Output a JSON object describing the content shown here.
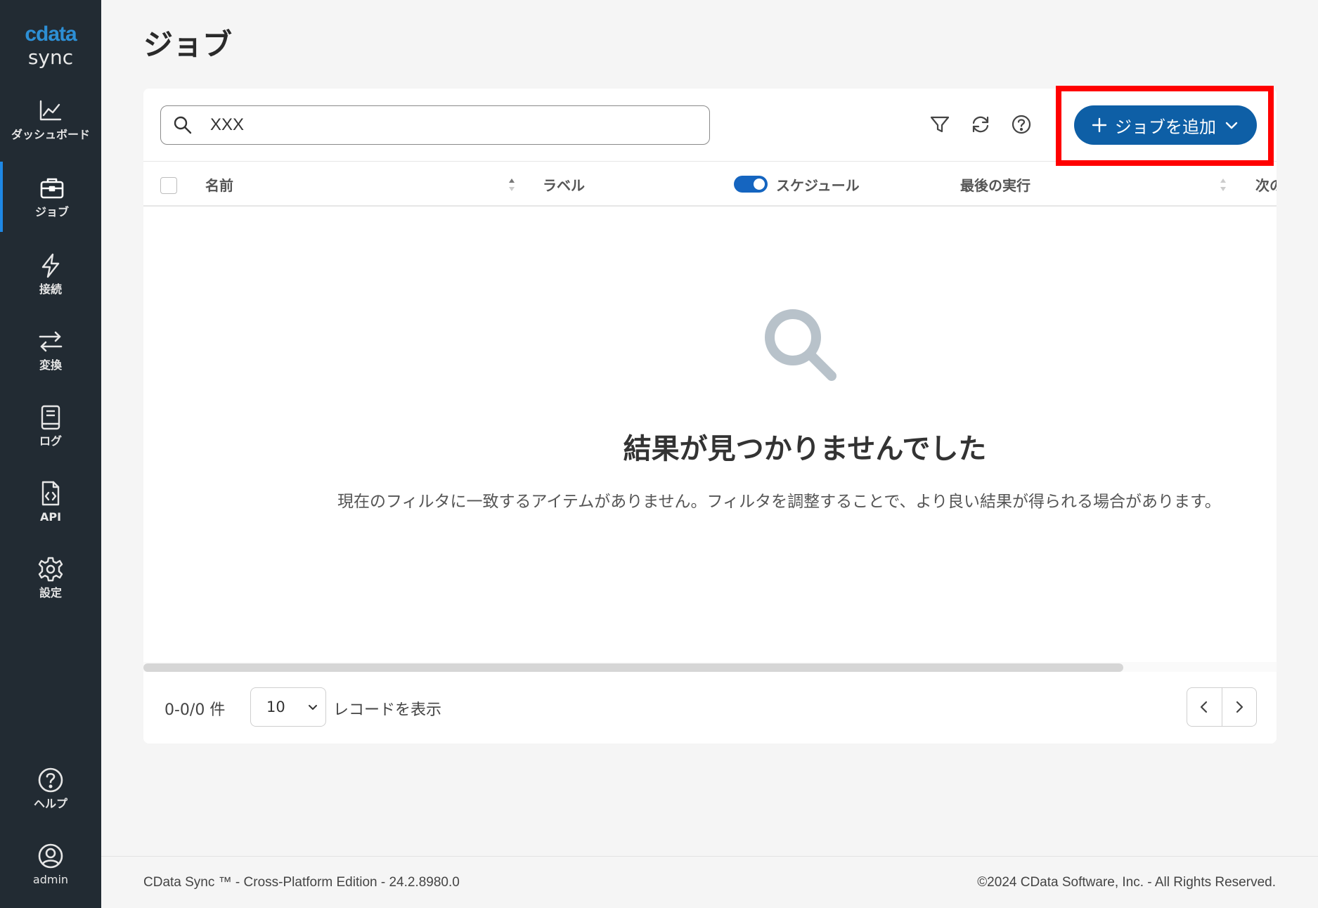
{
  "logo": {
    "top": "cdata",
    "bottom": "sync"
  },
  "sidebar": {
    "items": [
      {
        "label": "ダッシュボード",
        "icon": "chart-line-icon"
      },
      {
        "label": "ジョブ",
        "icon": "briefcase-icon",
        "active": true
      },
      {
        "label": "接続",
        "icon": "lightning-icon"
      },
      {
        "label": "変換",
        "icon": "arrows-exchange-icon"
      },
      {
        "label": "ログ",
        "icon": "book-icon"
      },
      {
        "label": "API",
        "icon": "code-file-icon"
      },
      {
        "label": "設定",
        "icon": "gear-icon"
      },
      {
        "label": "ヘルプ",
        "icon": "help-circle-icon"
      },
      {
        "label": "admin",
        "icon": "user-circle-icon"
      }
    ]
  },
  "page": {
    "title": "ジョブ"
  },
  "search": {
    "value": "XXX",
    "placeholder": ""
  },
  "toolbar": {
    "add_button_label": "ジョブを追加"
  },
  "table": {
    "columns": [
      "名前",
      "ラベル",
      "スケジュール",
      "最後の実行",
      "次の"
    ],
    "schedule_toggle_on": true
  },
  "empty_state": {
    "title": "結果が見つかりませんでした",
    "description": "現在のフィルタに一致するアイテムがありません。フィルタを調整することで、より良い結果が得られる場合があります。"
  },
  "pager": {
    "range": "0-0/0 件",
    "page_size": "10",
    "suffix": "レコードを表示"
  },
  "footer": {
    "left": "CData Sync ™ - Cross-Platform Edition - 24.2.8980.0",
    "right": "©2024 CData Software, Inc. - All Rights Reserved."
  },
  "colors": {
    "sidebar_bg": "#222b33",
    "accent": "#0e5fa6",
    "highlight": "#ff0000"
  }
}
